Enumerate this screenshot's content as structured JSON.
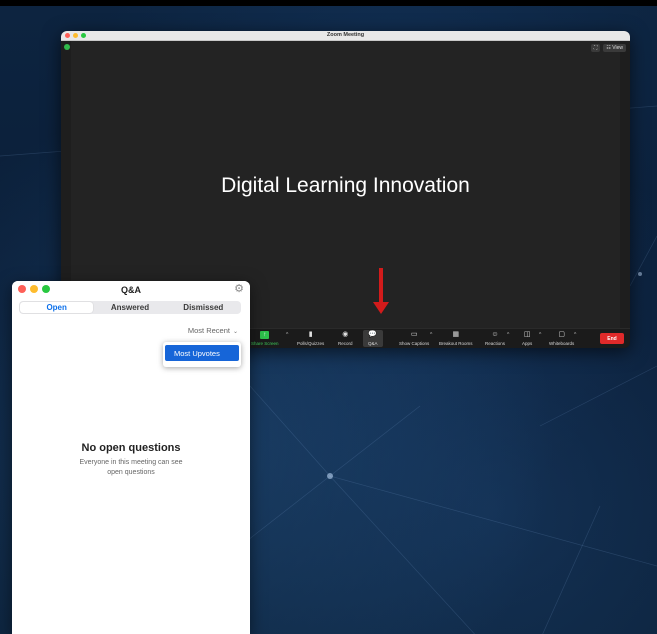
{
  "zoom_window": {
    "title": "Zoom Meeting",
    "view_label": "View",
    "slide_title": "Digital Learning Innovation",
    "toolbar": [
      {
        "label": "Share Screen",
        "icon": "share-screen-icon"
      },
      {
        "label": "Polls/Quizzes",
        "icon": "polls-icon"
      },
      {
        "label": "Record",
        "icon": "record-icon"
      },
      {
        "label": "Q&A",
        "icon": "qa-icon"
      },
      {
        "label": "Show Captions",
        "icon": "captions-icon"
      },
      {
        "label": "Breakout Rooms",
        "icon": "breakout-rooms-icon"
      },
      {
        "label": "Reactions",
        "icon": "reactions-icon"
      },
      {
        "label": "Apps",
        "icon": "apps-icon"
      },
      {
        "label": "Whiteboards",
        "icon": "whiteboards-icon"
      }
    ],
    "end_label": "End",
    "colors": {
      "end": "#e02a2a",
      "share": "#2ec24c"
    }
  },
  "qa_window": {
    "title": "Q&A",
    "tabs": [
      {
        "label": "Open",
        "active": true
      },
      {
        "label": "Answered",
        "active": false
      },
      {
        "label": "Dismissed",
        "active": false
      }
    ],
    "sort_label": "Most Recent",
    "dropdown_option": "Most Upvotes",
    "empty_title": "No open questions",
    "empty_subtitle": "Everyone in this meeting can see open questions",
    "colors": {
      "accent": "#0e71eb",
      "selected": "#1665d8"
    }
  },
  "annotation": {
    "arrow_color": "#d21b1b"
  }
}
